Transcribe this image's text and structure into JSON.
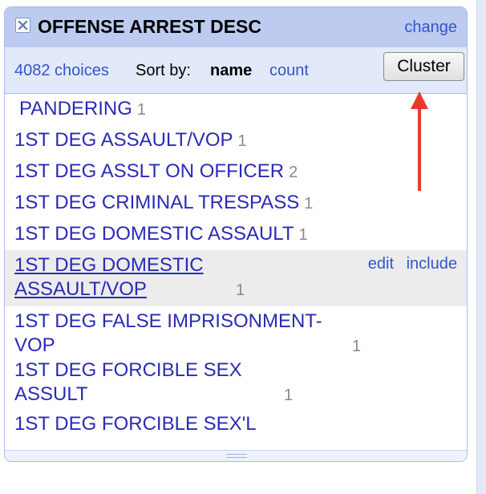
{
  "facet": {
    "title": "OFFENSE ARREST DESC",
    "change_label": "change",
    "choices_count": "4082 choices",
    "sort_label": "Sort by:",
    "sort_name": "name",
    "sort_count": "count",
    "cluster_label": "Cluster",
    "row_actions": {
      "edit": "edit",
      "include": "include"
    },
    "items": [
      {
        "label": "PANDERING",
        "count": "1"
      },
      {
        "label": "1ST DEG ASSAULT/VOP",
        "count": "1"
      },
      {
        "label": "1ST DEG ASSLT ON OFFICER",
        "count": "2"
      },
      {
        "label": "1ST DEG CRIMINAL TRESPASS",
        "count": "1"
      },
      {
        "label": "1ST DEG DOMESTIC ASSAULT",
        "count": "1"
      },
      {
        "label": "1ST DEG DOMESTIC ASSAULT/VOP",
        "count": "1"
      },
      {
        "label": "1ST DEG FALSE IMPRISONMENT-VOP",
        "count": "1"
      },
      {
        "label": "1ST DEG FORCIBLE SEX ASSULT",
        "count": "1"
      },
      {
        "label": "1ST DEG FORCIBLE SEX'L",
        "count": ""
      }
    ]
  },
  "colors": {
    "header_bg": "#bccbef",
    "controls_bg": "#e2e9f9",
    "link": "#3355cc",
    "choice_text": "#2a2ab8",
    "count_text": "#8a8a8a",
    "annotation_arrow": "#e53b2c"
  },
  "icons": {
    "close": "close-icon",
    "annotation": "red-arrow-annotation"
  }
}
